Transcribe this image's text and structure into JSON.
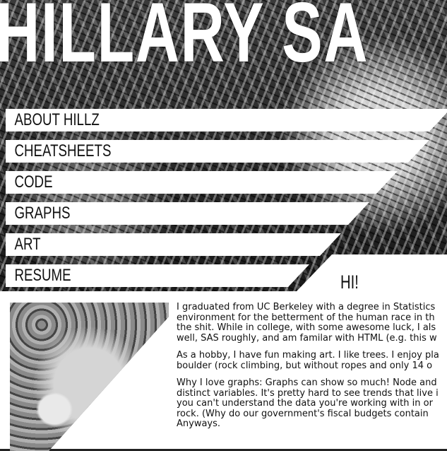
{
  "site": {
    "title": "HILLARY SA"
  },
  "nav": {
    "items": [
      {
        "label": "ABOUT HILLZ"
      },
      {
        "label": "CHEATSHEETS"
      },
      {
        "label": "CODE"
      },
      {
        "label": "GRAPHS"
      },
      {
        "label": "ART"
      },
      {
        "label": "RESUME"
      }
    ]
  },
  "main": {
    "heading": "HI!",
    "paragraphs": [
      [
        "I graduated from UC Berkeley with a degree in Statistics",
        "environment for the betterment of the human race in th",
        "the shit. While in college, with some awesome luck, I als",
        "well, SAS roughly, and am familar with HTML (e.g. this w"
      ],
      [
        "As a hobby, I have fun making art. I like trees. I enjoy pla",
        "boulder (rock climbing, but without ropes and only 14 o"
      ],
      [
        "Why I love graphs: Graphs can show so much! Node and",
        "distinct variables. It's pretty hard to see trends that live i",
        "you can't understand the data you're working with in or",
        "rock. (Why do our government's fiscal budgets contain",
        "Anyways."
      ]
    ]
  },
  "colors": {
    "panel": "#ffffff",
    "text": "#111111",
    "background": "#222222"
  }
}
